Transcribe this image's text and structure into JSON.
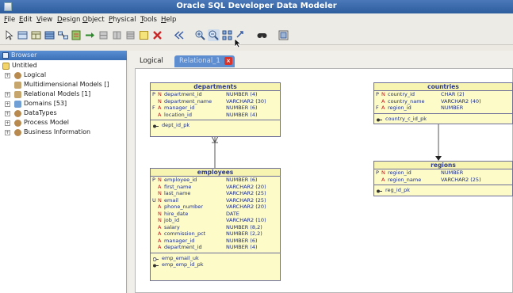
{
  "window": {
    "title": "Oracle SQL Developer Data Modeler"
  },
  "menu": [
    "File",
    "Edit",
    "View",
    "Design",
    "Object",
    "Physical",
    "Tools",
    "Help"
  ],
  "toolbar": [
    "pointer-icon",
    "entity-icon",
    "view-icon",
    "table-icon",
    "relation-icon",
    "note-icon",
    "arrow-icon",
    "grid-icon",
    "grid2-icon",
    "grid3-icon",
    "note2-icon",
    "delete-icon",
    "back-icon",
    "zoom-in-icon",
    "zoom-out-icon",
    "fit-icon",
    "refresh-icon",
    "find-icon",
    "layout-icon"
  ],
  "browser": {
    "title": "Browser",
    "root": "Untitled",
    "items": [
      {
        "label": "Logical",
        "icon": "logical-icon"
      },
      {
        "label": "Multidimensional Models []",
        "icon": "multidim-icon"
      },
      {
        "label": "Relational Models [1]",
        "icon": "relational-icon"
      },
      {
        "label": "Domains [53]",
        "icon": "domains-icon"
      },
      {
        "label": "DataTypes",
        "icon": "datatypes-icon"
      },
      {
        "label": "Process Model",
        "icon": "process-icon"
      },
      {
        "label": "Business Information",
        "icon": "business-icon"
      }
    ]
  },
  "tabs": {
    "logical": "Logical",
    "relational": "Relational_1"
  },
  "tables": {
    "departments": {
      "name": "departments",
      "columns": [
        {
          "f1": "P",
          "f2": "N",
          "name": "department_id",
          "type": "NUMBER (4)"
        },
        {
          "f1": "",
          "f2": "N",
          "name": "department_name",
          "type": "VARCHAR2 (30)"
        },
        {
          "f1": "F",
          "f2": "A",
          "name": "manager_id",
          "type": "NUMBER (6)"
        },
        {
          "f1": "",
          "f2": "A",
          "name": "location_id",
          "type": "NUMBER (4)"
        }
      ],
      "keys": [
        {
          "icon": "pk-icon",
          "label": "dept_id_pk"
        }
      ]
    },
    "countries": {
      "name": "countries",
      "columns": [
        {
          "f1": "P",
          "f2": "N",
          "name": "country_id",
          "type": "CHAR (2)"
        },
        {
          "f1": "",
          "f2": "A",
          "name": "country_name",
          "type": "VARCHAR2 (40)"
        },
        {
          "f1": "F",
          "f2": "A",
          "name": "region_id",
          "type": "NUMBER"
        }
      ],
      "keys": [
        {
          "icon": "pk-icon",
          "label": "country_c_id_pk"
        }
      ]
    },
    "employees": {
      "name": "employees",
      "columns": [
        {
          "f1": "P",
          "f2": "N",
          "name": "employee_id",
          "type": "NUMBER (6)"
        },
        {
          "f1": "",
          "f2": "A",
          "name": "first_name",
          "type": "VARCHAR2 (20)"
        },
        {
          "f1": "",
          "f2": "N",
          "name": "last_name",
          "type": "VARCHAR2 (25)"
        },
        {
          "f1": "U",
          "f2": "N",
          "name": "email",
          "type": "VARCHAR2 (25)"
        },
        {
          "f1": "",
          "f2": "A",
          "name": "phone_number",
          "type": "VARCHAR2 (20)"
        },
        {
          "f1": "",
          "f2": "N",
          "name": "hire_date",
          "type": "DATE"
        },
        {
          "f1": "",
          "f2": "N",
          "name": "job_id",
          "type": "VARCHAR2 (10)"
        },
        {
          "f1": "",
          "f2": "A",
          "name": "salary",
          "type": "NUMBER (8,2)"
        },
        {
          "f1": "",
          "f2": "A",
          "name": "commission_pct",
          "type": "NUMBER (2,2)"
        },
        {
          "f1": "",
          "f2": "A",
          "name": "manager_id",
          "type": "NUMBER (6)"
        },
        {
          "f1": "",
          "f2": "A",
          "name": "department_id",
          "type": "NUMBER (4)"
        }
      ],
      "keys": [
        {
          "icon": "uk-icon",
          "label": "emp_email_uk"
        },
        {
          "icon": "pk-icon",
          "label": "emp_emp_id_pk"
        }
      ]
    },
    "regions": {
      "name": "regions",
      "columns": [
        {
          "f1": "P",
          "f2": "N",
          "name": "region_id",
          "type": "NUMBER"
        },
        {
          "f1": "",
          "f2": "A",
          "name": "region_name",
          "type": "VARCHAR2 (25)"
        }
      ],
      "keys": [
        {
          "icon": "pk-icon",
          "label": "reg_id_pk"
        }
      ]
    }
  },
  "colors": {
    "title_bar": "#2e5d9d",
    "table_fill": "#fdfcc9",
    "table_border": "#6d6d99",
    "tab_active": "#5e8ed0"
  }
}
